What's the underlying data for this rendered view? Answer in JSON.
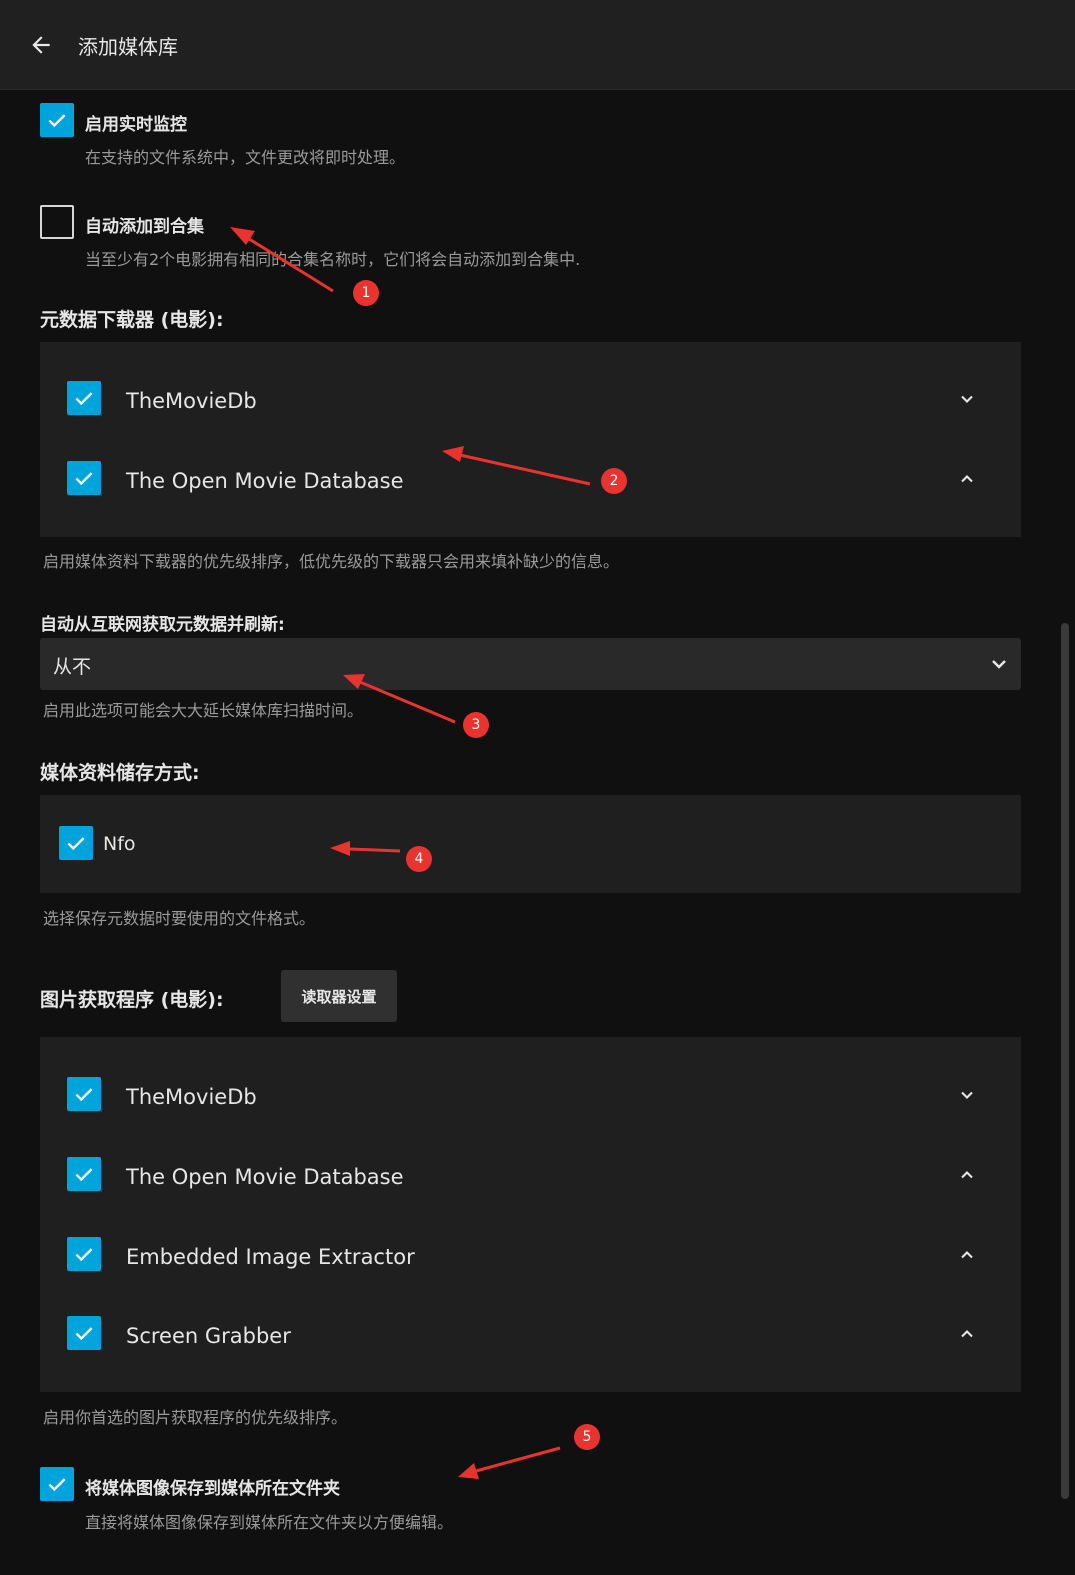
{
  "header": {
    "title": "添加媒体库"
  },
  "realtime": {
    "label": "启用实时监控",
    "desc": "在支持的文件系统中，文件更改将即时处理。",
    "checked": true
  },
  "auto_collection": {
    "label": "自动添加到合集",
    "desc": "当至少有2个电影拥有相同的合集名称时，它们将会自动添加到合集中.",
    "checked": false
  },
  "metadata_downloaders": {
    "title": "元数据下载器 (电影):",
    "items": [
      {
        "name": "TheMovieDb",
        "checked": true,
        "chevron": "down"
      },
      {
        "name": "The Open Movie Database",
        "checked": true,
        "chevron": "up"
      }
    ],
    "desc": "启用媒体资料下载器的优先级排序，低优先级的下载器只会用来填补缺少的信息。"
  },
  "refresh": {
    "label": "自动从互联网获取元数据并刷新:",
    "value": "从不",
    "desc": "启用此选项可能会大大延长媒体库扫描时间。"
  },
  "metadata_savers": {
    "title": "媒体资料储存方式:",
    "items": [
      {
        "name": "Nfo",
        "checked": true
      }
    ],
    "desc": "选择保存元数据时要使用的文件格式。"
  },
  "image_fetchers": {
    "title": "图片获取程序 (电影):",
    "settings_button": "读取器设置",
    "items": [
      {
        "name": "TheMovieDb",
        "checked": true,
        "chevron": "down"
      },
      {
        "name": "The Open Movie Database",
        "checked": true,
        "chevron": "up"
      },
      {
        "name": "Embedded Image Extractor",
        "checked": true,
        "chevron": "up"
      },
      {
        "name": "Screen Grabber",
        "checked": true,
        "chevron": "up"
      }
    ],
    "desc": "启用你首选的图片获取程序的优先级排序。"
  },
  "save_local": {
    "label": "将媒体图像保存到媒体所在文件夹",
    "desc": "直接将媒体图像保存到媒体所在文件夹以方便编辑。",
    "checked": true
  },
  "annotations": [
    "1",
    "2",
    "3",
    "4",
    "5"
  ],
  "colors": {
    "accent": "#00a4dc",
    "annotation": "#e8332f",
    "background": "#101010",
    "panel": "#1f1f1f"
  }
}
